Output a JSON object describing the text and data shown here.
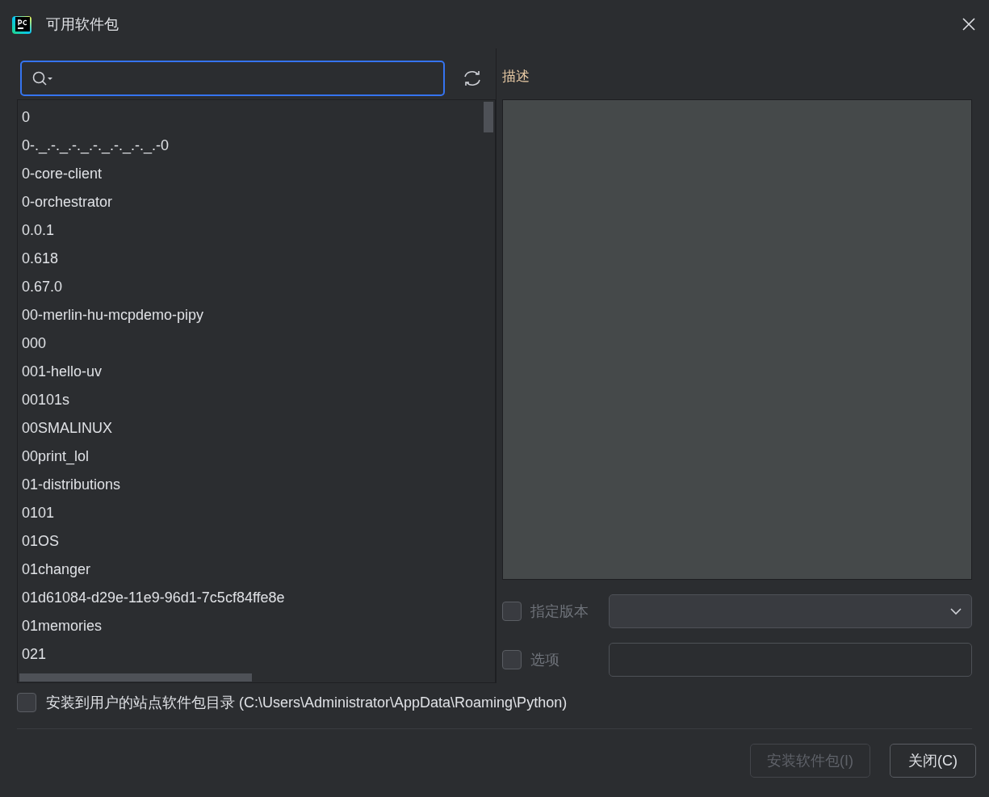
{
  "window": {
    "title": "可用软件包"
  },
  "packages": [
    "0",
    "0-._.-._.-._.-._.-._.-._.-0",
    "0-core-client",
    "0-orchestrator",
    "0.0.1",
    "0.618",
    "0.67.0",
    "00-merlin-hu-mcpdemo-pipy",
    "000",
    "001-hello-uv",
    "00101s",
    "00SMALINUX",
    "00print_lol",
    "01-distributions",
    "0101",
    "01OS",
    "01changer",
    "01d61084-d29e-11e9-96d1-7c5cf84ffe8e",
    "01memories",
    "021"
  ],
  "description": {
    "label": "描述"
  },
  "options": [
    {
      "kind": "dropdown",
      "label": "指定版本",
      "checked": false
    },
    {
      "kind": "text",
      "label": "选项",
      "checked": false
    }
  ],
  "install_to_user": {
    "label": "安装到用户的站点软件包目录 (C:\\Users\\Administrator\\AppData\\Roaming\\Python)",
    "checked": false
  },
  "buttons": [
    {
      "label": "安装软件包(I)",
      "disabled": true
    },
    {
      "label": "关闭(C)",
      "disabled": false
    }
  ]
}
